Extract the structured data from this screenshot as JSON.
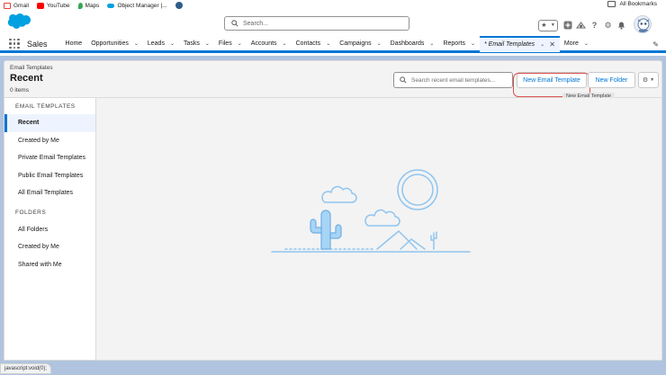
{
  "bookmarks": [
    {
      "label": "Gmail",
      "color": "#ea4335"
    },
    {
      "label": "YouTube",
      "color": "#ff0000"
    },
    {
      "label": "Maps",
      "color": "#34a853"
    },
    {
      "label": "Object Manager |...",
      "color": "#00a1e0"
    }
  ],
  "bookmarks_all": "All Bookmarks",
  "header": {
    "search_placeholder": "Search..."
  },
  "nav": {
    "app_name": "Sales",
    "items": [
      {
        "label": "Home"
      },
      {
        "label": "Opportunities"
      },
      {
        "label": "Leads"
      },
      {
        "label": "Tasks"
      },
      {
        "label": "Files"
      },
      {
        "label": "Accounts"
      },
      {
        "label": "Contacts"
      },
      {
        "label": "Campaigns"
      },
      {
        "label": "Dashboards"
      },
      {
        "label": "Reports"
      }
    ],
    "active_tab": "* Email Templates",
    "more": "More"
  },
  "list_header": {
    "object": "Email Templates",
    "title": "Recent",
    "count": "0 items",
    "search_placeholder": "Search recent email templates...",
    "new_button": "New Email Template",
    "tooltip": "New Email Template",
    "folder_button": "New Folder"
  },
  "sidebar": {
    "section1": "EMAIL TEMPLATES",
    "templates": [
      "Recent",
      "Created by Me",
      "Private Email Templates",
      "Public Email Templates",
      "All Email Templates"
    ],
    "section2": "FOLDERS",
    "folders": [
      "All Folders",
      "Created by Me",
      "Shared with Me"
    ]
  },
  "status_bar": "javascript:void(0);",
  "colors": {
    "brand": "#0176d3",
    "page_bg": "#b0c4df",
    "highlight": "#d9534f"
  }
}
